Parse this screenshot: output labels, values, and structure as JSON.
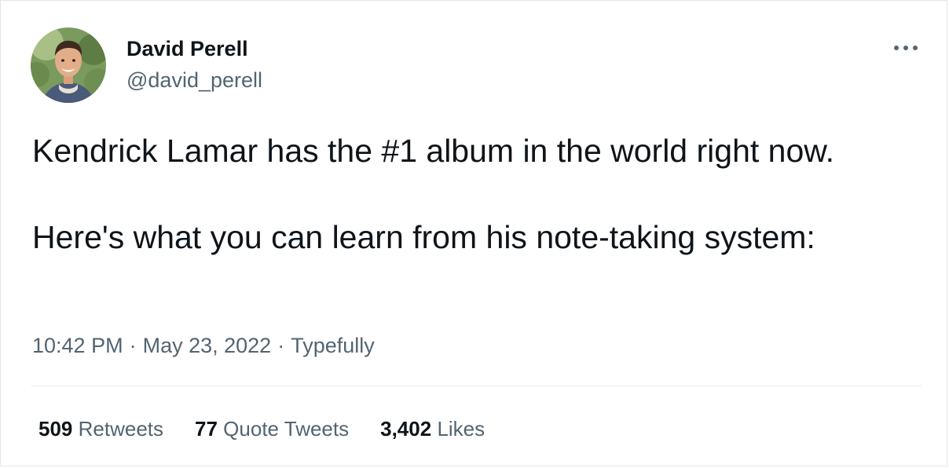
{
  "author": {
    "name": "David Perell",
    "handle": "@david_perell",
    "avatar_icon": "profile-photo-icon"
  },
  "tweet": {
    "paragraphs": [
      "Kendrick Lamar has the #1 album in the world right now.",
      "Here's what you can learn from his note-taking system:"
    ],
    "time": "10:42 PM",
    "date": "May 23, 2022",
    "source": "Typefully",
    "separator": "·"
  },
  "stats": {
    "retweets": {
      "count": "509",
      "label": "Retweets"
    },
    "quotes": {
      "count": "77",
      "label": "Quote Tweets"
    },
    "likes": {
      "count": "3,402",
      "label": "Likes"
    }
  },
  "menu_icon": "more-horizontal-icon",
  "colors": {
    "text": "#0f1419",
    "secondary": "#536471",
    "divider": "#e6ecf0"
  }
}
